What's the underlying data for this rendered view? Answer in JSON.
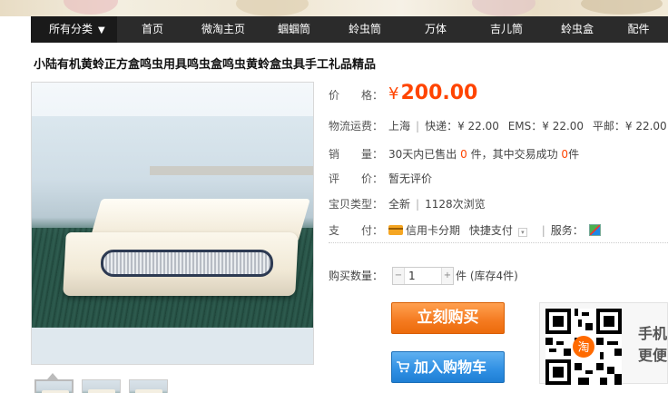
{
  "nav": {
    "first": "所有分类",
    "items": [
      "首页",
      "微淘主页",
      "蝈蝈筒",
      "蛉虫筒",
      "万体",
      "吉儿筒",
      "蛉虫盒",
      "配件"
    ]
  },
  "product": {
    "title": "小陆有机黄蛉正方盒鸣虫用具鸣虫盒鸣虫黄蛉盒虫具手工礼品精品"
  },
  "price": {
    "label": "价　　格：",
    "symbol": "¥",
    "value": "200.00"
  },
  "shipping": {
    "label": "物流运费：",
    "from": "上海",
    "express": "快递：¥ 22.00",
    "ems": "EMS：¥ 22.00",
    "surface": "平邮：¥ 22.00"
  },
  "sales": {
    "label": "销　　量：",
    "prefix": "30天内已售出",
    "sold": "0",
    "mid": "件，其中交易成功",
    "success": "0",
    "suffix": "件"
  },
  "rating": {
    "label": "评　　价：",
    "value": "暂无评价"
  },
  "item_type": {
    "label": "宝贝类型：",
    "condition": "全新",
    "views": "1128次浏览"
  },
  "payment": {
    "label": "支　　付：",
    "installment": "信用卡分期",
    "quick_pay": "快捷支付",
    "service_label": "服务："
  },
  "quantity": {
    "label": "购买数量：",
    "value": "1",
    "stock": "件 (库存4件)"
  },
  "buttons": {
    "buy_now": "立刻购买",
    "add_to_cart": "加入购物车"
  },
  "mobile": {
    "line1": "手机",
    "line2": "更便",
    "qr_badge": "淘"
  },
  "colors": {
    "accent": "#ff4400",
    "buy_button": "#f47a1f",
    "cart_button": "#2f8fe3",
    "nav_bg": "#2b2b2b"
  }
}
